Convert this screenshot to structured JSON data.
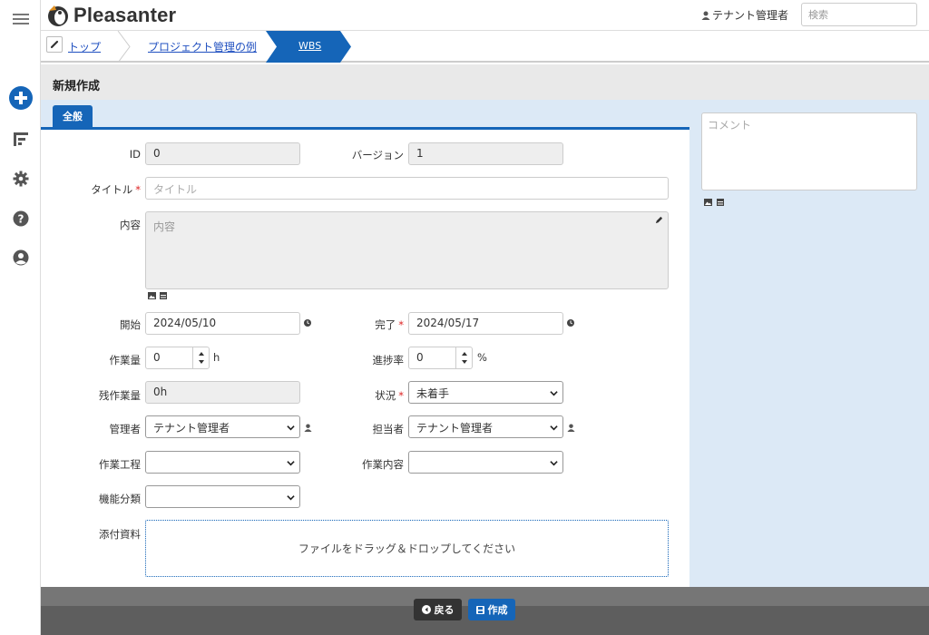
{
  "app": {
    "name": "Pleasanter"
  },
  "header": {
    "user_name": "テナント管理者",
    "search_placeholder": "検索"
  },
  "breadcrumb": {
    "items": [
      "トップ",
      "プロジェクト管理の例",
      "WBS"
    ]
  },
  "page_title": "新規作成",
  "tabs": [
    "全般"
  ],
  "form": {
    "id_label": "ID",
    "id_value": "0",
    "version_label": "バージョン",
    "version_value": "1",
    "title_label": "タイトル",
    "title_placeholder": "タイトル",
    "body_label": "内容",
    "body_placeholder": "内容",
    "start_label": "開始",
    "start_value": "2024/05/10",
    "end_label": "完了",
    "end_value": "2024/05/17",
    "workload_label": "作業量",
    "workload_value": "0",
    "workload_unit": "h",
    "progress_label": "進捗率",
    "progress_value": "0",
    "progress_unit": "%",
    "remaining_label": "残作業量",
    "remaining_value": "0h",
    "status_label": "状況",
    "status_value": "未着手",
    "manager_label": "管理者",
    "manager_value": "テナント管理者",
    "owner_label": "担当者",
    "owner_value": "テナント管理者",
    "process_label": "作業工程",
    "process_value": "",
    "work_content_label": "作業内容",
    "work_content_value": "",
    "category_label": "機能分類",
    "category_value": "",
    "attachments_label": "添付資料",
    "attachments_dropzone": "ファイルをドラッグ＆ドロップしてください",
    "required_mark": "*"
  },
  "side": {
    "comment_placeholder": "コメント"
  },
  "footer": {
    "back_label": "戻る",
    "create_label": "作成"
  },
  "colors": {
    "accent": "#1565b8",
    "panel_bg": "#dce9f6",
    "required": "#dd2222",
    "footer": "#5e5e5e"
  }
}
